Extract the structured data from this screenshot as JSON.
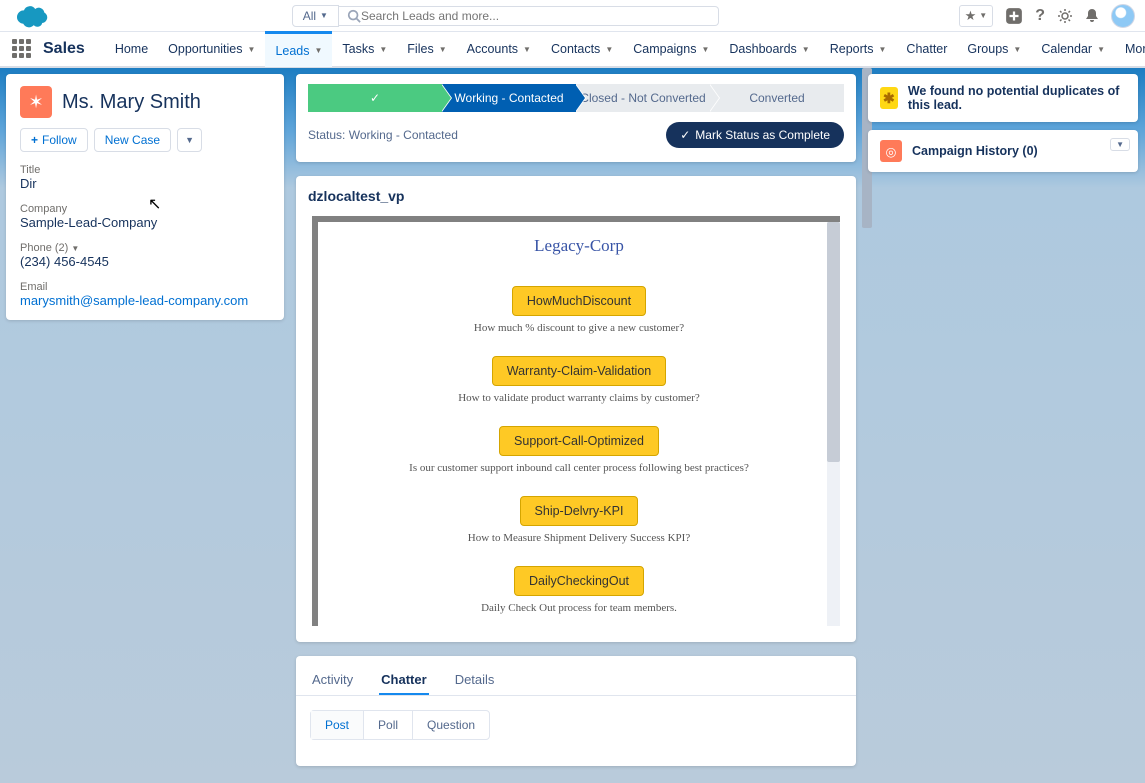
{
  "search": {
    "scope": "All",
    "placeholder": "Search Leads and more..."
  },
  "appName": "Sales",
  "nav": {
    "home": "Home",
    "opp": "Opportunities",
    "leads": "Leads",
    "tasks": "Tasks",
    "files": "Files",
    "accounts": "Accounts",
    "contacts": "Contacts",
    "campaigns": "Campaigns",
    "dashboards": "Dashboards",
    "reports": "Reports",
    "chatter": "Chatter",
    "groups": "Groups",
    "calendar": "Calendar",
    "more": "More"
  },
  "lead": {
    "name": "Ms. Mary Smith",
    "followLabel": "Follow",
    "newCaseLabel": "New Case",
    "titleLabel": "Title",
    "titleValue": "Dir",
    "companyLabel": "Company",
    "companyValue": "Sample-Lead-Company",
    "phoneLabel": "Phone (2)",
    "phoneValue": "(234) 456-4545",
    "emailLabel": "Email",
    "emailValue": "marysmith@sample-lead-company.com"
  },
  "path": {
    "stages": {
      "working": "Working - Contacted",
      "closed": "Closed - Not Converted",
      "converted": "Converted"
    },
    "statusLabel": "Status:",
    "statusValue": "Working - Contacted",
    "markButton": "Mark Status as Complete"
  },
  "vp": {
    "title": "dzlocaltest_vp",
    "brand": "Legacy-Corp",
    "items": [
      {
        "btn": "HowMuchDiscount",
        "desc": "How much % discount to give a new customer?"
      },
      {
        "btn": "Warranty-Claim-Validation",
        "desc": "How to validate product warranty claims by customer?"
      },
      {
        "btn": "Support-Call-Optimized",
        "desc": "Is our customer support inbound call center process following best practices?"
      },
      {
        "btn": "Ship-Delvry-KPI",
        "desc": "How to Measure Shipment Delivery Success KPI?"
      },
      {
        "btn": "DailyCheckingOut",
        "desc": "Daily Check Out process for team members."
      }
    ]
  },
  "tabs": {
    "activity": "Activity",
    "chatter": "Chatter",
    "details": "Details"
  },
  "chatterSubtabs": {
    "post": "Post",
    "poll": "Poll",
    "question": "Question"
  },
  "right": {
    "duplicates": "We found no potential duplicates of this lead.",
    "campaignHistory": "Campaign History (0)"
  }
}
